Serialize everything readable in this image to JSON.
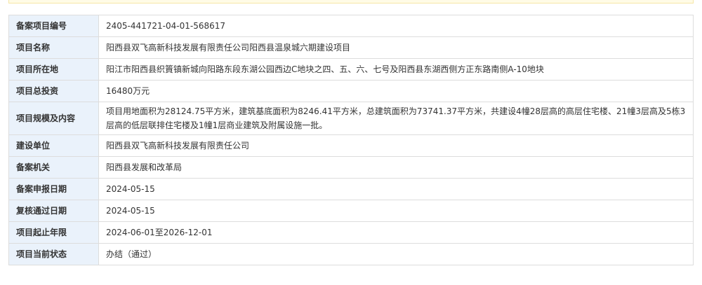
{
  "rows": [
    {
      "label": "备案项目编号",
      "value": "2405-441721-04-01-568617"
    },
    {
      "label": "项目名称",
      "value": "阳西县双飞高新科技发展有限责任公司阳西县温泉城六期建设项目"
    },
    {
      "label": "项目所在地",
      "value": "阳江市阳西县织篢镇新城向阳路东段东湖公园西边C地块之四、五、六、七号及阳西县东湖西侧方正东路南侧A-10地块"
    },
    {
      "label": "项目总投资",
      "value": "16480万元"
    },
    {
      "label": "项目规模及内容",
      "value": "项目用地面积为28124.75平方米，建筑基底面积为8246.41平方米，总建筑面积为73741.37平方米，共建设4幢28层高的高层住宅楼、21幢3层高及5栋3层高的低层联排住宅楼及1幢1层商业建筑及附属设施一批。"
    },
    {
      "label": "建设单位",
      "value": "阳西县双飞高新科技发展有限责任公司"
    },
    {
      "label": "备案机关",
      "value": "阳西县发展和改革局"
    },
    {
      "label": "备案申报日期",
      "value": "2024-05-15"
    },
    {
      "label": "复核通过日期",
      "value": "2024-05-15"
    },
    {
      "label": "项目起止年限",
      "value": "2024-06-01至2026-12-01"
    },
    {
      "label": "项目当前状态",
      "value": "办结（通过）"
    }
  ]
}
